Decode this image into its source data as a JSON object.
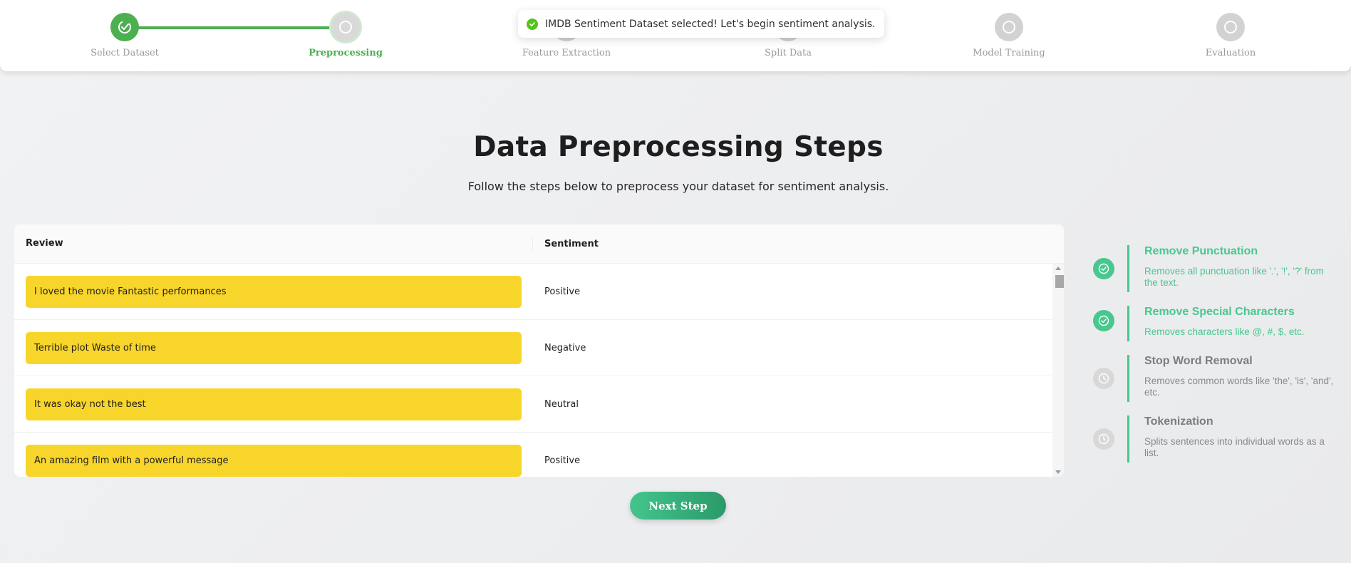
{
  "stepper": {
    "steps": [
      {
        "label": "Select Dataset",
        "state": "done",
        "icon": "check-circle-icon"
      },
      {
        "label": "Preprocessing",
        "state": "active",
        "icon": "circle-icon"
      },
      {
        "label": "Feature Extraction",
        "state": "pending",
        "icon": "circle-icon"
      },
      {
        "label": "Split Data",
        "state": "pending",
        "icon": "circle-icon"
      },
      {
        "label": "Model Training",
        "state": "pending",
        "icon": "circle-icon"
      },
      {
        "label": "Evaluation",
        "state": "pending",
        "icon": "circle-icon"
      }
    ]
  },
  "toast": {
    "message": "IMDB Sentiment Dataset selected! Let's begin sentiment analysis.",
    "icon": "check-circle-icon",
    "color": "#52c41a"
  },
  "main": {
    "title": "Data Preprocessing Steps",
    "subtitle": "Follow the steps below to preprocess your dataset for sentiment analysis."
  },
  "table": {
    "columns": [
      "Review",
      "Sentiment"
    ],
    "rows": [
      {
        "review": "I loved the movie Fantastic performances",
        "sentiment": "Positive"
      },
      {
        "review": "Terrible plot Waste of time",
        "sentiment": "Negative"
      },
      {
        "review": "It was okay not the best",
        "sentiment": "Neutral"
      },
      {
        "review": "An amazing film with a powerful message",
        "sentiment": "Positive"
      }
    ]
  },
  "next_button": {
    "label": "Next Step"
  },
  "preprocess_steps": [
    {
      "title": "Remove Punctuation",
      "desc": "Removes all punctuation like '.', '!', '?' from the text.",
      "state": "done",
      "icon": "check-circle-icon"
    },
    {
      "title": "Remove Special Characters",
      "desc": "Removes characters like @, #, $, etc.",
      "state": "done",
      "icon": "check-circle-icon"
    },
    {
      "title": "Stop Word Removal",
      "desc": "Removes common words like 'the', 'is', 'and', etc.",
      "state": "pending",
      "icon": "clock-icon"
    },
    {
      "title": "Tokenization",
      "desc": "Splits sentences into individual words as a list.",
      "state": "pending",
      "icon": "clock-icon"
    }
  ],
  "colors": {
    "accent": "#4caf50",
    "highlight": "#f8d52a",
    "done_step": "#48c78e",
    "pending_step": "#d8d8d8"
  }
}
